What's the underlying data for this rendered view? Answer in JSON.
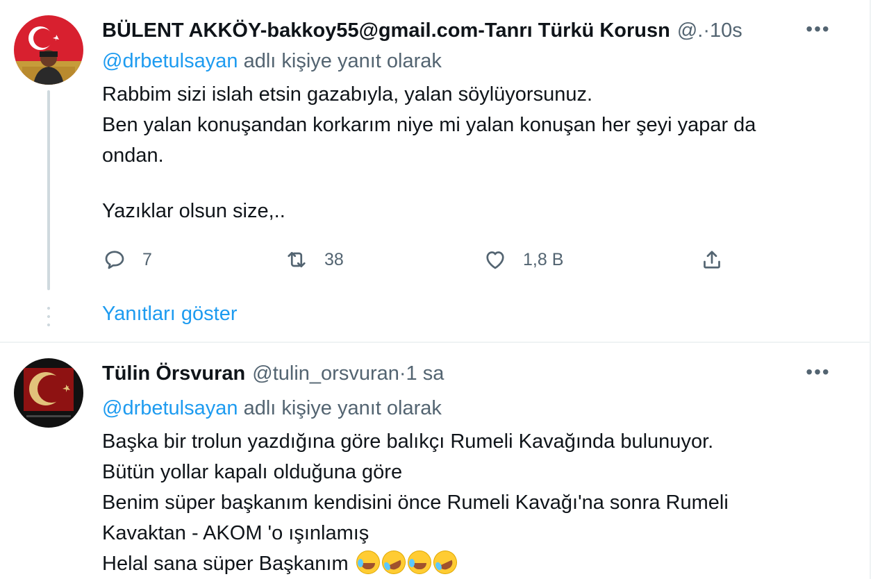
{
  "tweets": [
    {
      "name": "BÜLENT AKKÖY-bakkoy55@gmail.com-Tanrı Türkü Korusn",
      "handle": "@.",
      "time": "10s",
      "reply_prefix": "@drbetulsayan",
      "reply_suffix": "adlı kişiye yanıt olarak",
      "lines": [
        "Rabbim sizi islah etsin gazabıyla, yalan söylüyorsunuz.",
        "Ben yalan konuşandan korkarım niye mi yalan konuşan her şeyi yapar da",
        "ondan.",
        "",
        "Yazıklar olsun size,.."
      ],
      "actions": {
        "reply_count": "7",
        "retweet_count": "38",
        "like_count": "1,8 B"
      },
      "show_replies": "Yanıtları göster"
    },
    {
      "name": "Tülin Örsvuran",
      "handle": "@tulin_orsvuran",
      "time": "1 sa",
      "reply_prefix": "@drbetulsayan",
      "reply_suffix": "adlı kişiye yanıt olarak",
      "lines": [
        "Başka bir trolun yazdığına göre balıkçı Rumeli Kavağında bulunuyor.",
        "Bütün yollar kapalı olduğuna göre",
        "Benim süper başkanım kendisini önce Rumeli Kavağı'na sonra Rumeli",
        "Kavaktan - AKOM 'o ışınlamış",
        "Helal sana süper Başkanım"
      ]
    }
  ],
  "separator": " · ",
  "more_label": "•••",
  "colors": {
    "accent": "#1d9bf0",
    "muted": "#536471",
    "text": "#0f1419"
  },
  "icons": [
    "reply-icon",
    "retweet-icon",
    "like-icon",
    "share-icon",
    "more-icon"
  ]
}
